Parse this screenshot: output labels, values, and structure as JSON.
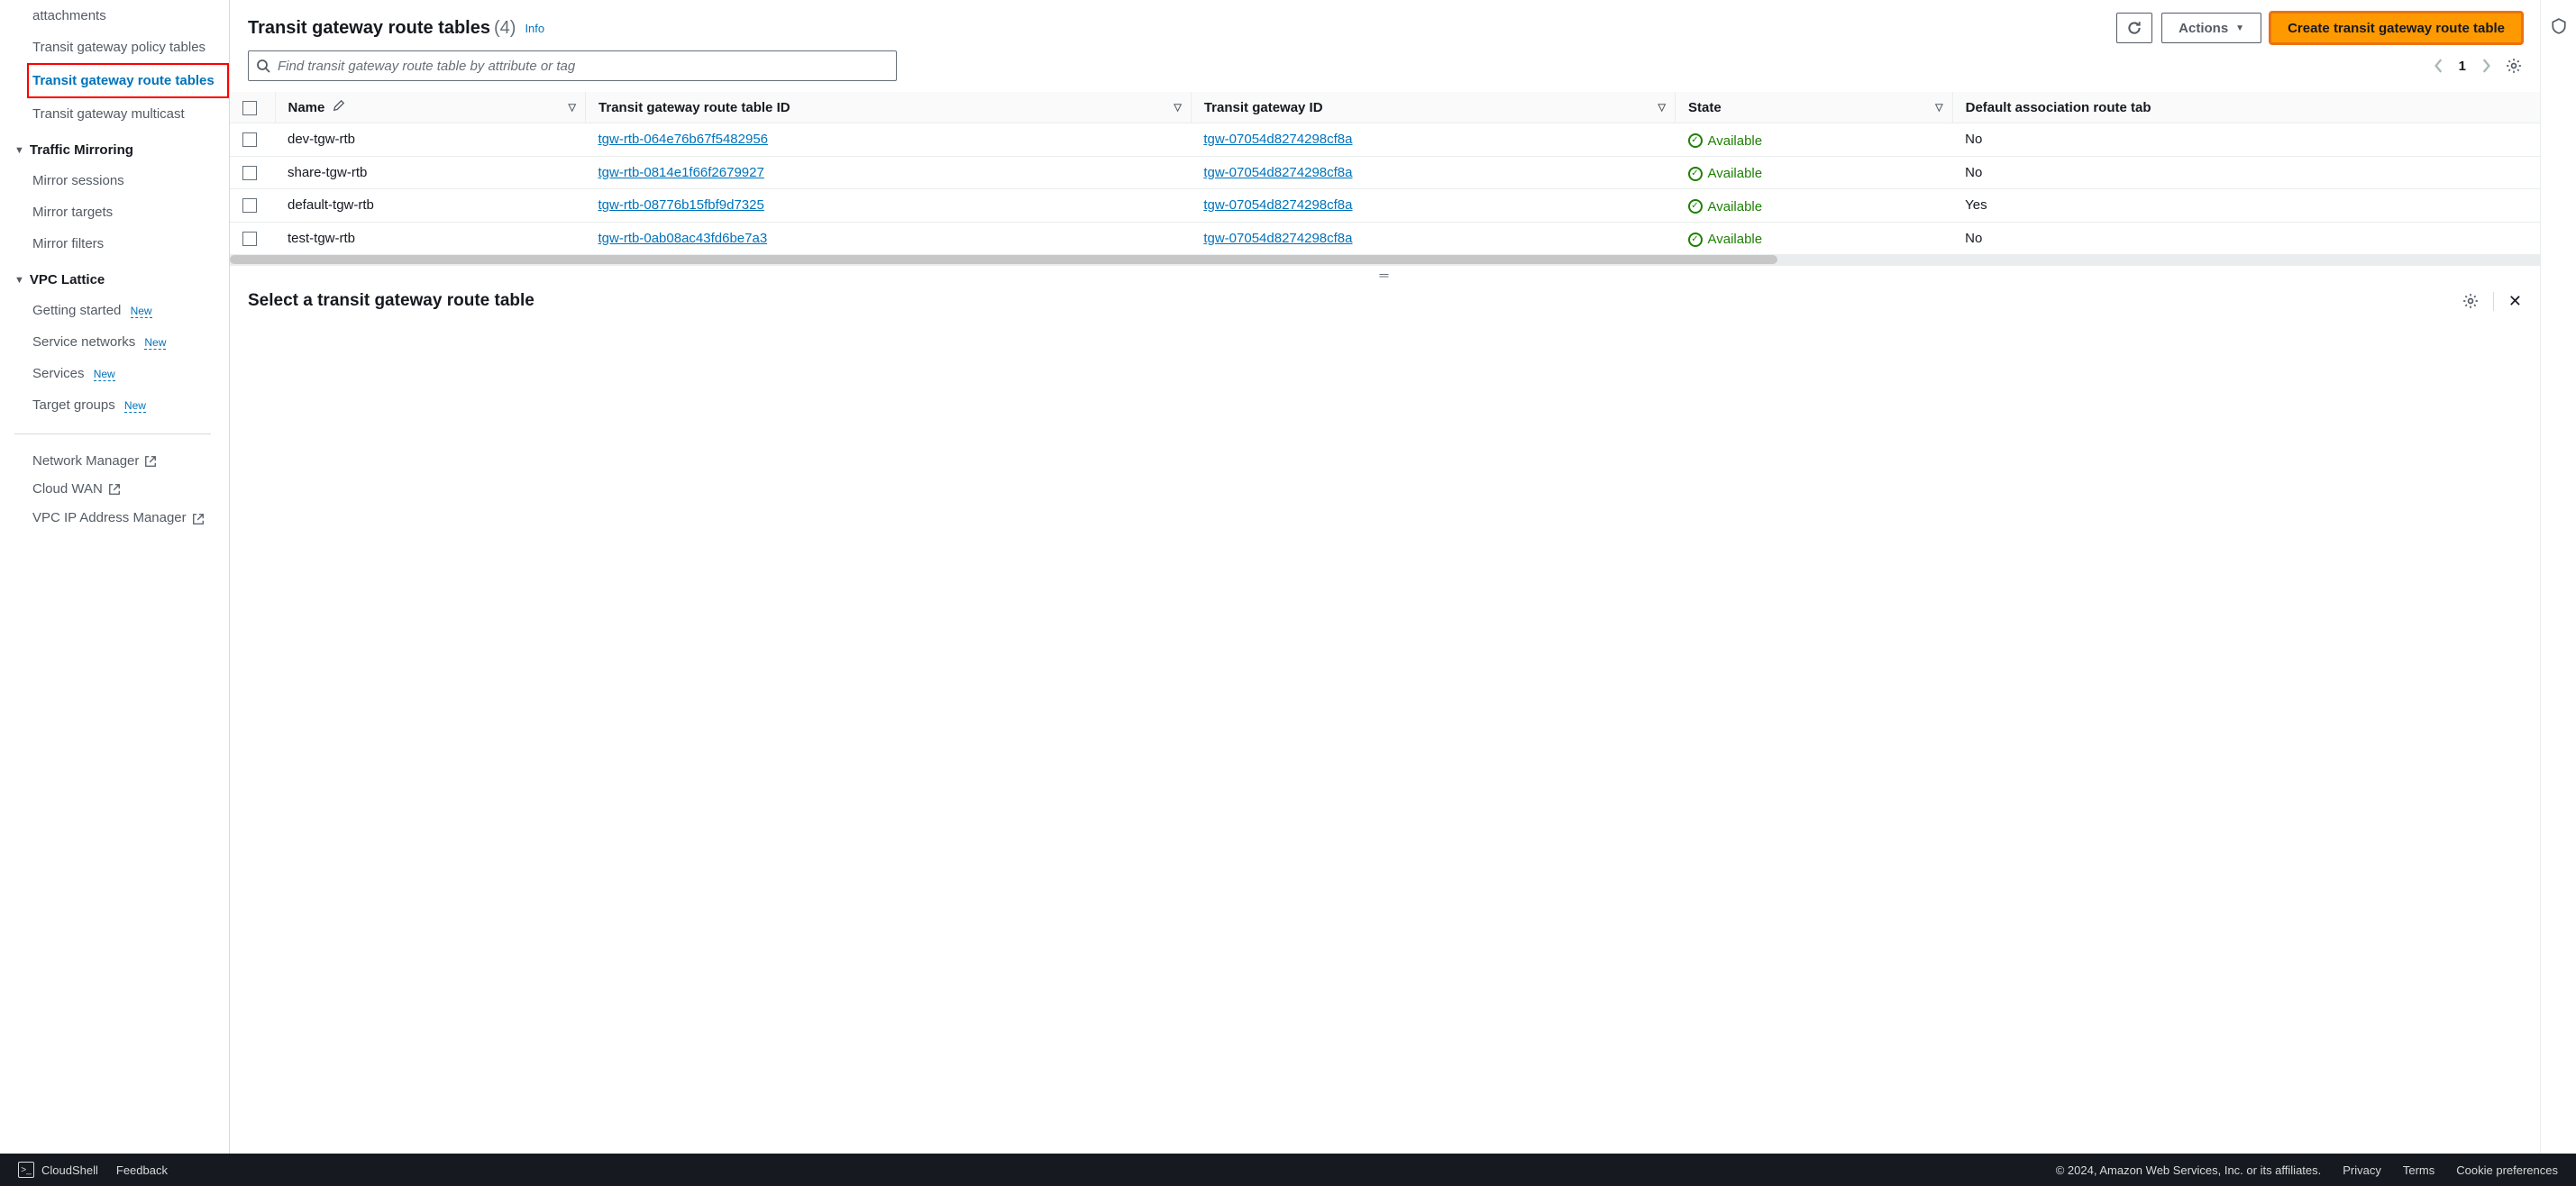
{
  "sidebar": {
    "items_top": [
      {
        "label": "attachments"
      },
      {
        "label": "Transit gateway policy tables"
      },
      {
        "label": "Transit gateway route tables",
        "active": true
      },
      {
        "label": "Transit gateway multicast"
      }
    ],
    "traffic_mirroring": {
      "title": "Traffic Mirroring",
      "items": [
        "Mirror sessions",
        "Mirror targets",
        "Mirror filters"
      ]
    },
    "vpc_lattice": {
      "title": "VPC Lattice",
      "items": [
        {
          "label": "Getting started",
          "new": "New"
        },
        {
          "label": "Service networks",
          "new": "New"
        },
        {
          "label": "Services",
          "new": "New"
        },
        {
          "label": "Target groups",
          "new": "New"
        }
      ]
    },
    "external": [
      {
        "label": "Network Manager"
      },
      {
        "label": "Cloud WAN"
      },
      {
        "label": "VPC IP Address Manager"
      }
    ]
  },
  "header": {
    "title": "Transit gateway route tables",
    "count": "(4)",
    "info": "Info",
    "actions_label": "Actions",
    "create_label": "Create transit gateway route table"
  },
  "search": {
    "placeholder": "Find transit gateway route table by attribute or tag"
  },
  "pager": {
    "page": "1"
  },
  "table": {
    "cols": {
      "name": "Name",
      "rtb_id": "Transit gateway route table ID",
      "tgw_id": "Transit gateway ID",
      "state": "State",
      "default_assoc": "Default association route tab"
    },
    "rows": [
      {
        "name": "dev-tgw-rtb",
        "rtb": "tgw-rtb-064e76b67f5482956",
        "tgw": "tgw-07054d8274298cf8a",
        "state": "Available",
        "assoc": "No"
      },
      {
        "name": "share-tgw-rtb",
        "rtb": "tgw-rtb-0814e1f66f2679927",
        "tgw": "tgw-07054d8274298cf8a",
        "state": "Available",
        "assoc": "No"
      },
      {
        "name": "default-tgw-rtb",
        "rtb": "tgw-rtb-08776b15fbf9d7325",
        "tgw": "tgw-07054d8274298cf8a",
        "state": "Available",
        "assoc": "Yes"
      },
      {
        "name": "test-tgw-rtb",
        "rtb": "tgw-rtb-0ab08ac43fd6be7a3",
        "tgw": "tgw-07054d8274298cf8a",
        "state": "Available",
        "assoc": "No"
      }
    ]
  },
  "details": {
    "title": "Select a transit gateway route table"
  },
  "footer": {
    "cloudshell": "CloudShell",
    "feedback": "Feedback",
    "copyright": "© 2024, Amazon Web Services, Inc. or its affiliates.",
    "privacy": "Privacy",
    "terms": "Terms",
    "cookies": "Cookie preferences"
  }
}
